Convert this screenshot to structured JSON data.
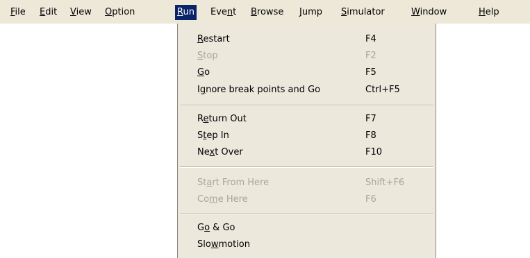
{
  "menubar": {
    "items": [
      {
        "label": "File",
        "mnemonic": "F"
      },
      {
        "label": "Edit",
        "mnemonic": "E"
      },
      {
        "label": "View",
        "mnemonic": "V"
      },
      {
        "label": "Option",
        "mnemonic": "O"
      },
      {
        "label": "Run",
        "mnemonic": "R",
        "active": true
      },
      {
        "label": "Event",
        "mnemonic": "n"
      },
      {
        "label": "Browse",
        "mnemonic": "B"
      },
      {
        "label": "Jump",
        "mnemonic": "J"
      },
      {
        "label": "Simulator",
        "mnemonic": "S"
      },
      {
        "label": "Window",
        "mnemonic": "W"
      },
      {
        "label": "Help",
        "mnemonic": "H"
      }
    ]
  },
  "run_menu": {
    "items": [
      {
        "label": "Restart",
        "mnemonic": "R",
        "shortcut": "F4",
        "enabled": true
      },
      {
        "label": "Stop",
        "mnemonic": "S",
        "shortcut": "F2",
        "enabled": false
      },
      {
        "label": "Go",
        "mnemonic": "G",
        "shortcut": "F5",
        "enabled": true
      },
      {
        "label": "Ignore break points and Go",
        "mnemonic": "g",
        "shortcut": "Ctrl+F5",
        "enabled": true
      },
      {
        "separator": true
      },
      {
        "label": "Return Out",
        "mnemonic": "e",
        "shortcut": "F7",
        "enabled": true
      },
      {
        "label": "Step In",
        "mnemonic": "t",
        "shortcut": "F8",
        "enabled": true
      },
      {
        "label": "Next Over",
        "mnemonic": "x",
        "shortcut": "F10",
        "enabled": true
      },
      {
        "separator": true
      },
      {
        "label": "Start From Here",
        "mnemonic": "a",
        "shortcut": "Shift+F6",
        "enabled": false
      },
      {
        "label": "Come Here",
        "mnemonic": "m",
        "shortcut": "F6",
        "enabled": false
      },
      {
        "separator": true
      },
      {
        "label": "Go & Go",
        "mnemonic": "o",
        "shortcut": "",
        "enabled": true
      },
      {
        "label": "Slowmotion",
        "mnemonic": "w",
        "shortcut": "",
        "enabled": true
      }
    ]
  }
}
